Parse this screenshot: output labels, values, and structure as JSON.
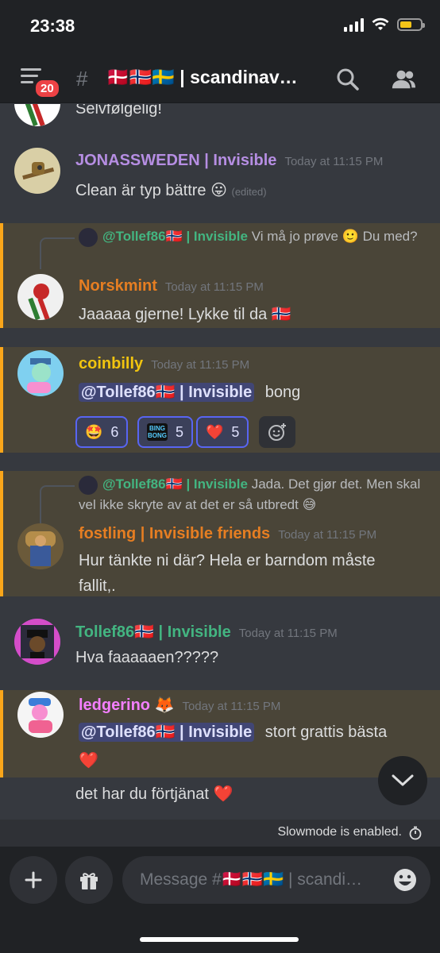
{
  "status": {
    "time": "23:38"
  },
  "header": {
    "badge": "20",
    "channel": "🇩🇰🇳🇴🇸🇪 | scandinav…"
  },
  "messages": [
    {
      "text": "Selvfølgelig!"
    },
    {
      "username": "JONASSWEDEN | Invisible",
      "color": "#b68ee3",
      "timestamp": "Today at 11:15 PM",
      "text": "Clean är typ bättre 😛",
      "edited": "(edited)"
    },
    {
      "reply_name": "@Tollef86🇳🇴 | Invisible",
      "reply_text": "Vi må jo prøve 🙂 Du med?",
      "username": "Norskmint",
      "color": "#e67e22",
      "timestamp": "Today at 11:15 PM",
      "text": "Jaaaaa gjerne! Lykke til da 🇳🇴"
    },
    {
      "username": "coinbilly",
      "color": "#f1c40f",
      "timestamp": "Today at 11:15 PM",
      "mention": "@Tollef86🇳🇴 | Invisible",
      "text": "bong",
      "reactions": [
        {
          "emoji": "🤩",
          "count": "6"
        },
        {
          "emoji": "BING BONG",
          "count": "5"
        },
        {
          "emoji": "❤️",
          "count": "5"
        }
      ]
    },
    {
      "reply_name": "@Tollef86🇳🇴 | Invisible",
      "reply_text": "Jada. Det gjør det. Men skal vel ikke skryte av at det er så utbredt 😅",
      "username": "fostling | Invisible friends",
      "color": "#e67e22",
      "timestamp": "Today at 11:15 PM",
      "text1": "Hur tänkte ni där? Hela er barndom måste",
      "text2": "fallit,."
    },
    {
      "username": "Tollef86🇳🇴 | Invisible",
      "color": "#43b581",
      "timestamp": "Today at 11:15 PM",
      "text": "Hva faaaaaen?????"
    },
    {
      "username": "ledgerino 🦊",
      "color": "#f47fff",
      "timestamp": "Today at 11:15 PM",
      "mention": "@Tollef86🇳🇴 | Invisible",
      "text": "stort grattis bästa",
      "text2": "❤️",
      "text3": "det har du förtjänat ❤️"
    }
  ],
  "slowmode": "Slowmode is enabled.",
  "input": {
    "placeholder": "Message #🇩🇰🇳🇴🇸🇪 | scandi…"
  },
  "colors": {
    "mention_bg": "#4a4538",
    "mention_border": "#faa61a",
    "blurple": "#5865f2"
  }
}
